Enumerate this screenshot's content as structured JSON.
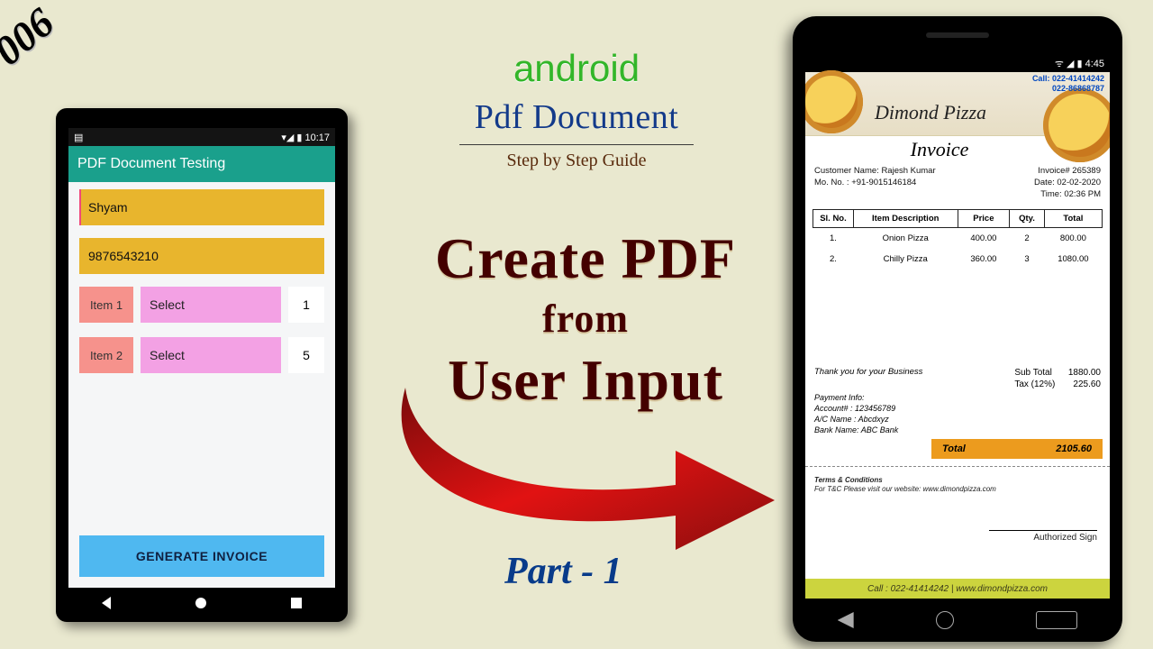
{
  "episode": "006",
  "titles": {
    "brand": "android",
    "heading": "Pdf Document",
    "sub": "Step by Step Guide",
    "line1": "Create PDF",
    "line2": "from",
    "line3": "User Input",
    "part": "Part - 1"
  },
  "left_phone": {
    "status_time": "10:17",
    "app_title": "PDF Document Testing",
    "name_input": "Shyam",
    "phone_input": "9876543210",
    "rows": [
      {
        "label": "Item 1",
        "select": "Select",
        "qty": "1"
      },
      {
        "label": "Item 2",
        "select": "Select",
        "qty": "5"
      }
    ],
    "button": "GENERATE INVOICE"
  },
  "right_phone": {
    "status_time": "4:45",
    "contact_label": "Call: 022-41414242",
    "contact2": "022-86868787",
    "shop_name": "Dimond Pizza",
    "invoice_title": "Invoice",
    "customer_name_label": "Customer Name: ",
    "customer_name": "Rajesh Kumar",
    "customer_mo_label": "Mo. No. : ",
    "customer_mo": "+91-9015146184",
    "invoice_no_label": "Invoice# ",
    "invoice_no": "265389",
    "date_label": "Date: ",
    "date": "02-02-2020",
    "time_label": "Time:  ",
    "time": "02:36 PM",
    "columns": [
      "Sl. No.",
      "Item Description",
      "Price",
      "Qty.",
      "Total"
    ],
    "items": [
      {
        "n": "1.",
        "desc": "Onion Pizza",
        "price": "400.00",
        "qty": "2",
        "total": "800.00"
      },
      {
        "n": "2.",
        "desc": "Chilly Pizza",
        "price": "360.00",
        "qty": "3",
        "total": "1080.00"
      }
    ],
    "thank": "Thank you for your Business",
    "subtotal_label": "Sub Total",
    "subtotal": "1880.00",
    "tax_label": "Tax (12%)",
    "tax": "225.60",
    "total_label": "Total",
    "total": "2105.60",
    "pay_title": "Payment Info:",
    "pay_acct": "Account# : 123456789",
    "pay_name": "A/C Name : Abcdxyz",
    "pay_bank": "Bank Name: ABC Bank",
    "terms_h": "Terms & Conditions",
    "terms_t": "For T&C Please visit our website: www.dimondpizza.com",
    "sign": "Authorized Sign",
    "footer": "Call : 022-41414242 | www.dimondpizza.com"
  }
}
